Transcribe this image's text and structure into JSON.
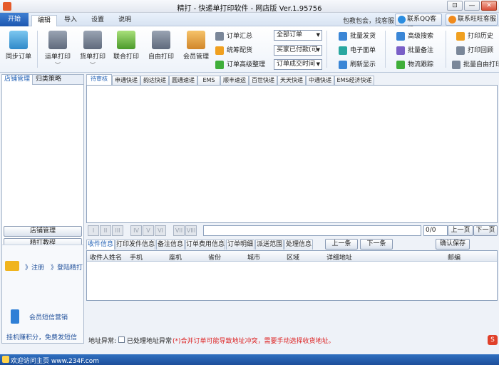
{
  "window": {
    "title": "精打 - 快递单打印软件 - 网店版 Ver.1.95756",
    "controls": [
      "⊡",
      "—",
      "✕"
    ]
  },
  "menu": {
    "start": "开始",
    "tabs": [
      "编辑",
      "导入",
      "设置",
      "说明"
    ],
    "slogan": "包教包会，找客服",
    "qq_service": "联系QQ客服",
    "wangwang_service": "联系旺旺客服"
  },
  "toolbar": {
    "sync_orders": "同步订单",
    "waybill_print": "运单打印",
    "goods_print": "货单打印",
    "combined_print": "联合打印",
    "free_print": "自由打印",
    "member_mgmt": "会员管理",
    "order_summary": "订单汇总",
    "distribution": "统筹配货",
    "order_advanced": "订单高级整理",
    "filter_orders": "全部订单",
    "filter_paid": "买家已付款(可",
    "filter_time": "订单成交时间",
    "batch_ship": "批量发货",
    "e_waybill": "电子面单",
    "refresh": "刷新显示",
    "advanced_search": "高级搜索",
    "batch_note": "批量备注",
    "logistics_track": "物流跟踪",
    "print_history": "打印历史",
    "print_reprint": "打印回顾",
    "batch_free_print": "批量自由打印",
    "arrow": "﹀"
  },
  "left_panel": {
    "tabs": [
      "店铺管理",
      "归类策略"
    ],
    "shop_mgmt_btn": "店铺管理",
    "tutorial_btn": "精打教程",
    "register": "》注册",
    "login": "》登陆精打",
    "sms_marketing": "会员短信营销",
    "free_sms": "挂机赚积分，免费发短信"
  },
  "courier_tabs": [
    "待审核",
    "申通快递",
    "韵达快递",
    "圆通速递",
    "EMS",
    "顺丰速运",
    "百世快递",
    "天天快递",
    "中通快递",
    "EMS经济快递"
  ],
  "pager": {
    "glyph_buttons": [
      "I",
      "II",
      "III",
      "IV",
      "V",
      "VI",
      "VII",
      "VIII"
    ],
    "page_value": "0/0",
    "prev": "上一页",
    "next": "下一页"
  },
  "detail_tabs": [
    "收件信息",
    "打印发件信息",
    "备注信息",
    "订单费用信息",
    "订单明细",
    "派送范围",
    "处理信息"
  ],
  "detail_actions": {
    "prev_item": "上一条",
    "next_item": "下一条",
    "confirm_save": "确认保存"
  },
  "detail_columns": [
    "收件人姓名",
    "手机",
    "座机",
    "省份",
    "城市",
    "区域",
    "详细地址",
    "邮编"
  ],
  "address": {
    "label": "地址异常:",
    "checkbox_label": "已处理地址异常",
    "warning": "(*)合并订单可能导致地址冲突，需要手动选择收货地址。"
  },
  "status_bar": {
    "text": "欢迎访问主页 www.234F.com"
  },
  "colors": {
    "accent": "#1d57b0",
    "status_bar": "#1d4f9a",
    "warning": "#dd2222"
  }
}
